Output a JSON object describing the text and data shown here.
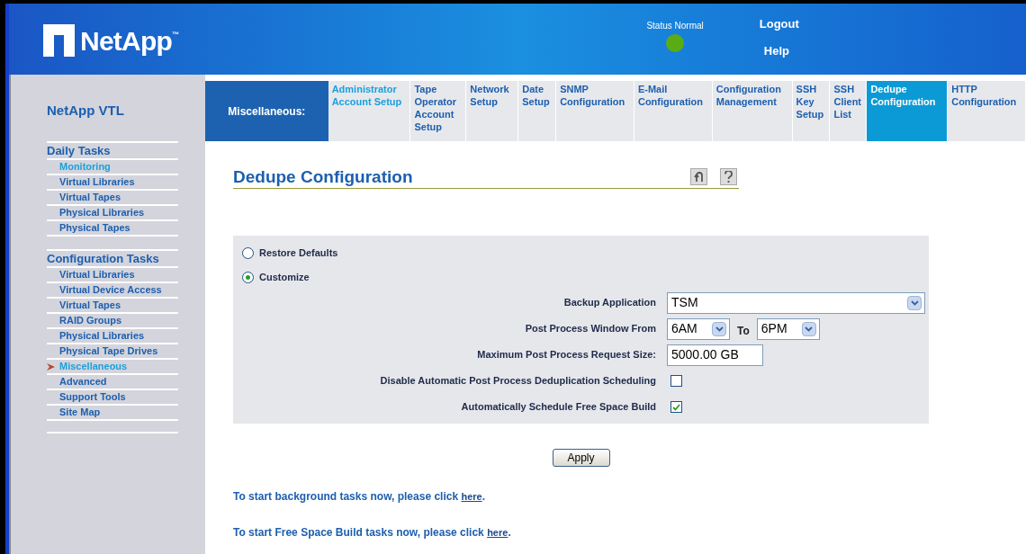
{
  "header": {
    "logo_text": "NetApp",
    "trademark": "™",
    "status_label": "Status Normal",
    "status_indicator": {
      "color": "#5aac14"
    },
    "links": [
      "Logout",
      "Help"
    ]
  },
  "sidebar": {
    "title": "NetApp VTL",
    "sections": [
      {
        "heading": "Daily Tasks",
        "items": [
          {
            "label": "Monitoring",
            "selected": false,
            "highlighted": true
          },
          {
            "label": "Virtual Libraries",
            "selected": false,
            "highlighted": false
          },
          {
            "label": "Virtual Tapes",
            "selected": false,
            "highlighted": false
          },
          {
            "label": "Physical Libraries",
            "selected": false,
            "highlighted": false
          },
          {
            "label": "Physical Tapes",
            "selected": false,
            "highlighted": false
          }
        ]
      },
      {
        "heading": "Configuration Tasks",
        "items": [
          {
            "label": "Virtual Libraries",
            "selected": false,
            "highlighted": false
          },
          {
            "label": "Virtual Device Access",
            "selected": false,
            "highlighted": false
          },
          {
            "label": "Virtual Tapes",
            "selected": false,
            "highlighted": false
          },
          {
            "label": "RAID Groups",
            "selected": false,
            "highlighted": false
          },
          {
            "label": "Physical Libraries",
            "selected": false,
            "highlighted": false
          },
          {
            "label": "Physical Tape Drives",
            "selected": false,
            "highlighted": false
          },
          {
            "label": "Miscellaneous",
            "selected": true,
            "highlighted": true
          },
          {
            "label": "Advanced",
            "selected": false,
            "highlighted": false
          },
          {
            "label": "Support Tools",
            "selected": false,
            "highlighted": false
          },
          {
            "label": "Site Map",
            "selected": false,
            "highlighted": false
          }
        ]
      }
    ]
  },
  "tabs": {
    "section_label": "Miscellaneous:",
    "items": [
      {
        "label": "Administrator Account Setup",
        "selected": false,
        "highlighted": true
      },
      {
        "label": "Tape Operator Account Setup",
        "selected": false,
        "highlighted": false
      },
      {
        "label": "Network Setup",
        "selected": false,
        "highlighted": false
      },
      {
        "label": "Date Setup",
        "selected": false,
        "highlighted": false
      },
      {
        "label": "SNMP Configuration",
        "selected": false,
        "highlighted": false
      },
      {
        "label": "E-Mail Configuration",
        "selected": false,
        "highlighted": false
      },
      {
        "label": "Configuration Management",
        "selected": false,
        "highlighted": false
      },
      {
        "label": "SSH Key Setup",
        "selected": false,
        "highlighted": false
      },
      {
        "label": "SSH Client List",
        "selected": false,
        "highlighted": false
      },
      {
        "label": "Dedupe Configuration",
        "selected": true,
        "highlighted": false
      },
      {
        "label": "HTTP Configuration",
        "selected": false,
        "highlighted": false
      }
    ]
  },
  "page": {
    "title": "Dedupe Configuration"
  },
  "form": {
    "options": [
      {
        "label": "Restore Defaults",
        "selected": false
      },
      {
        "label": "Customize",
        "selected": true
      }
    ],
    "fields": [
      {
        "kind": "select",
        "label": "Backup Application",
        "value": "TSM"
      },
      {
        "kind": "range",
        "label": "Post Process Window From",
        "from": "6AM",
        "connector": "To",
        "to": "6PM"
      },
      {
        "kind": "text",
        "label": "Maximum Post Process Request Size:",
        "value": "5000.00 GB"
      },
      {
        "kind": "checkbox",
        "label": "Disable Automatic Post Process Deduplication Scheduling",
        "checked": false
      },
      {
        "kind": "checkbox",
        "label": "Automatically Schedule Free Space Build",
        "checked": true
      }
    ]
  },
  "apply_button": "Apply",
  "notes": [
    {
      "text": "To start background tasks now, please click",
      "link": "here",
      "suffix": "."
    },
    {
      "text": "To start Free Space Build tasks now, please click",
      "link": "here",
      "suffix": "."
    }
  ]
}
